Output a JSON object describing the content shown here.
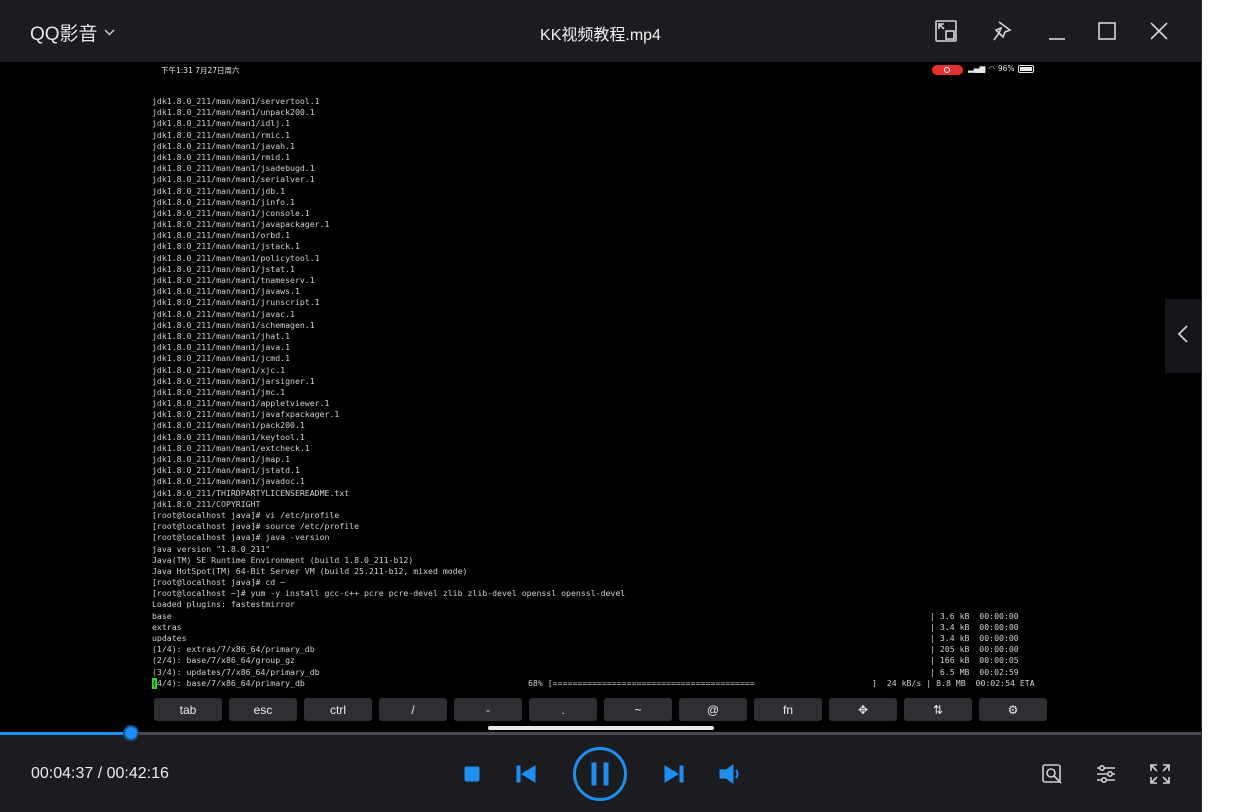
{
  "app": {
    "brand": "QQ影音",
    "title": "KK视频教程.mp4"
  },
  "titlebar_icons": [
    "mini-mode-icon",
    "pin-icon",
    "minimize-icon",
    "maximize-icon",
    "close-icon"
  ],
  "video": {
    "status_time": "下午1:31  7月27日周六",
    "status_right": "96%",
    "terminal_lines": [
      "jdk1.8.0_211/man/man1/servertool.1",
      "jdk1.8.0_211/man/man1/unpack200.1",
      "jdk1.8.0_211/man/man1/idlj.1",
      "jdk1.8.0_211/man/man1/rmic.1",
      "jdk1.8.0_211/man/man1/javah.1",
      "jdk1.8.0_211/man/man1/rmid.1",
      "jdk1.8.0_211/man/man1/jsadebugd.1",
      "jdk1.8.0_211/man/man1/serialver.1",
      "jdk1.8.0_211/man/man1/jdb.1",
      "jdk1.8.0_211/man/man1/jinfo.1",
      "jdk1.8.0_211/man/man1/jconsole.1",
      "jdk1.8.0_211/man/man1/javapackager.1",
      "jdk1.8.0_211/man/man1/orbd.1",
      "jdk1.8.0_211/man/man1/jstack.1",
      "jdk1.8.0_211/man/man1/policytool.1",
      "jdk1.8.0_211/man/man1/jstat.1",
      "jdk1.8.0_211/man/man1/tnameserv.1",
      "jdk1.8.0_211/man/man1/javaws.1",
      "jdk1.8.0_211/man/man1/jrunscript.1",
      "jdk1.8.0_211/man/man1/javac.1",
      "jdk1.8.0_211/man/man1/schemagen.1",
      "jdk1.8.0_211/man/man1/jhat.1",
      "jdk1.8.0_211/man/man1/java.1",
      "jdk1.8.0_211/man/man1/jcmd.1",
      "jdk1.8.0_211/man/man1/xjc.1",
      "jdk1.8.0_211/man/man1/jarsigner.1",
      "jdk1.8.0_211/man/man1/jmc.1",
      "jdk1.8.0_211/man/man1/appletviewer.1",
      "jdk1.8.0_211/man/man1/javafxpackager.1",
      "jdk1.8.0_211/man/man1/pack200.1",
      "jdk1.8.0_211/man/man1/keytool.1",
      "jdk1.8.0_211/man/man1/extcheck.1",
      "jdk1.8.0_211/man/man1/jmap.1",
      "jdk1.8.0_211/man/man1/jstatd.1",
      "jdk1.8.0_211/man/man1/javadoc.1",
      "jdk1.8.0_211/THIRDPARTYLICENSEREADME.txt",
      "jdk1.8.0_211/COPYRIGHT",
      "[root@localhost java]# vi /etc/profile",
      "[root@localhost java]# source /etc/profile",
      "[root@localhost java]# java -version",
      "java version \"1.8.0_211\"",
      "Java(TM) SE Runtime Environment (build 1.8.0_211-b12)",
      "Java HotSpot(TM) 64-Bit Server VM (build 25.211-b12, mixed mode)",
      "[root@localhost java]# cd ~",
      "[root@localhost ~]# yum -y install gcc-c++ pcre pcre-devel zlib zlib-devel openssl openssl-devel",
      "Loaded plugins: fastestmirror"
    ],
    "repo_lines": [
      {
        "left": "base",
        "right": "| 3.6 kB  00:00:00"
      },
      {
        "left": "extras",
        "right": "| 3.4 kB  00:00:00"
      },
      {
        "left": "updates",
        "right": "| 3.4 kB  00:00:00"
      },
      {
        "left": "(1/4): extras/7/x86_64/primary_db",
        "right": "| 205 kB  00:00:00"
      },
      {
        "left": "(2/4): base/7/x86_64/group_gz",
        "right": "| 166 kB  00:00:05"
      },
      {
        "left": "(3/4): updates/7/x86_64/primary_db",
        "right": "| 6.5 MB  00:02:59"
      }
    ],
    "last_line": {
      "cursor_char": "(",
      "left": "4/4): base/7/x86_64/primary_db",
      "progress": "68% [=========================================",
      "right": "]  24 kB/s | 8.8 MB  00:02:54 ETA"
    },
    "keys": [
      "tab",
      "esc",
      "ctrl",
      "/",
      "-",
      ".",
      "~",
      "@",
      "fn",
      "✥",
      "⇅",
      "⚙"
    ]
  },
  "player": {
    "current_time": "00:04:37",
    "total_time": "00:42:16",
    "progress_fraction": 0.109,
    "accent_color": "#1e8ff0",
    "controls": [
      "stop-icon",
      "previous-icon",
      "pause-icon",
      "next-icon",
      "volume-icon"
    ],
    "right_tools": [
      "toolbox-icon",
      "settings-sliders-icon",
      "fullscreen-icon"
    ]
  }
}
